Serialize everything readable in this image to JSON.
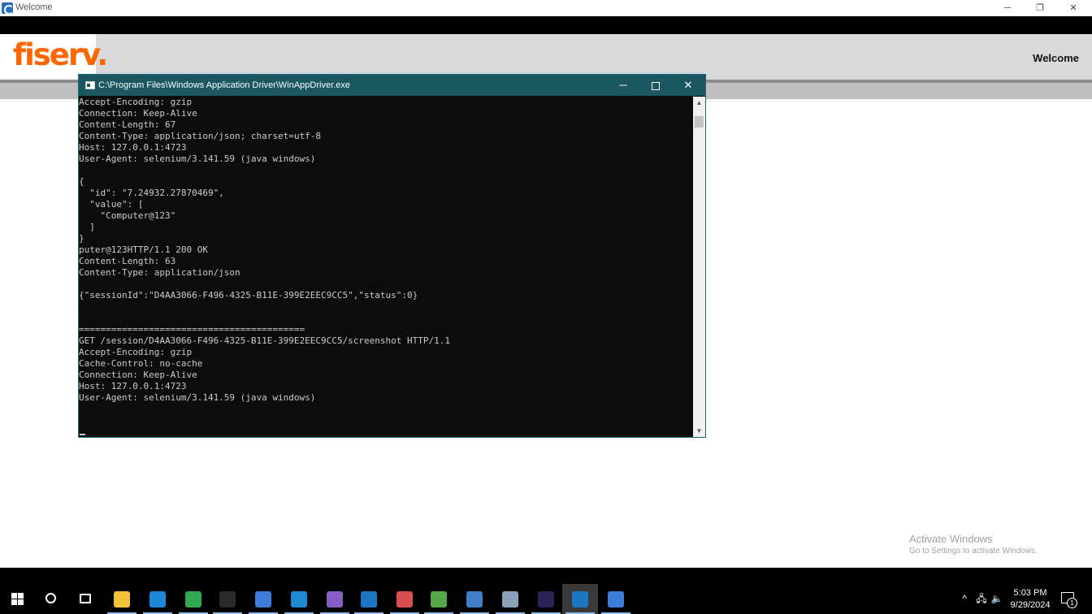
{
  "app": {
    "title": "Welcome",
    "window_controls": {
      "minimize": "─",
      "restore": "❐",
      "close": "✕"
    },
    "logo": "fiserv.",
    "header_label": "Welcome",
    "brand_color": "#ff6600"
  },
  "console": {
    "title": "C:\\Program Files\\Windows Application Driver\\WinAppDriver.exe",
    "controls": {
      "minimize": "─",
      "close": "✕"
    },
    "lines": [
      "Accept-Encoding: gzip",
      "Connection: Keep-Alive",
      "Content-Length: 67",
      "Content-Type: application/json; charset=utf-8",
      "Host: 127.0.0.1:4723",
      "User-Agent: selenium/3.141.59 (java windows)",
      "",
      "{",
      "  \"id\": \"7.24932.27870469\",",
      "  \"value\": [",
      "    \"Computer@123\"",
      "  ]",
      "}",
      "puter@123HTTP/1.1 200 OK",
      "Content-Length: 63",
      "Content-Type: application/json",
      "",
      "{\"sessionId\":\"D4AA3066-F496-4325-B11E-399E2EEC9CC5\",\"status\":0}",
      "",
      "",
      "==========================================",
      "GET /session/D4AA3066-F496-4325-B11E-399E2EEC9CC5/screenshot HTTP/1.1",
      "Accept-Encoding: gzip",
      "Cache-Control: no-cache",
      "Connection: Keep-Alive",
      "Host: 127.0.0.1:4723",
      "User-Agent: selenium/3.141.59 (java windows)"
    ]
  },
  "watermark": {
    "title": "Activate Windows",
    "subtitle": "Go to Settings to activate Windows."
  },
  "taskbar": {
    "items": [
      {
        "name": "start-button",
        "icon": "windows-logo-icon"
      },
      {
        "name": "search-button",
        "icon": "search-icon"
      },
      {
        "name": "task-view-button",
        "icon": "task-view-icon"
      },
      {
        "name": "file-explorer",
        "icon": "folder-icon",
        "color": "#f3c13a"
      },
      {
        "name": "edge",
        "icon": "edge-icon",
        "color": "#1e88d8"
      },
      {
        "name": "media-app",
        "icon": "media-icon",
        "color": "#2fa84f"
      },
      {
        "name": "command-prompt",
        "icon": "console-icon",
        "color": "#2b2b2b"
      },
      {
        "name": "app-shortcut",
        "icon": "app-icon",
        "color": "#3b7dd8"
      },
      {
        "name": "vscode",
        "icon": "vscode-icon",
        "color": "#1f8ad2"
      },
      {
        "name": "visual-studio",
        "icon": "visual-studio-icon",
        "color": "#865fc5"
      },
      {
        "name": "app-window",
        "icon": "window-icon",
        "color": "#1d76c4"
      },
      {
        "name": "paint-app",
        "icon": "paint-icon",
        "color": "#d94f4f"
      },
      {
        "name": "notepad-app",
        "icon": "notepad-icon",
        "color": "#56a846"
      },
      {
        "name": "remote-desktop",
        "icon": "computer-icon",
        "color": "#3f7fc8"
      },
      {
        "name": "devices-app",
        "icon": "devices-icon",
        "color": "#8aa2b8"
      },
      {
        "name": "eclipse",
        "icon": "eclipse-icon",
        "color": "#2c2255"
      },
      {
        "name": "winappdriver",
        "icon": "console-window-icon",
        "color": "#1d76c4"
      },
      {
        "name": "welcome-app",
        "icon": "app-icon",
        "color": "#3b7dd8"
      }
    ],
    "tray": {
      "chevron": "^",
      "network": "🖧",
      "volume": "🔈"
    },
    "time": "5:03 PM",
    "date": "9/29/2024",
    "notification_count": "1"
  }
}
